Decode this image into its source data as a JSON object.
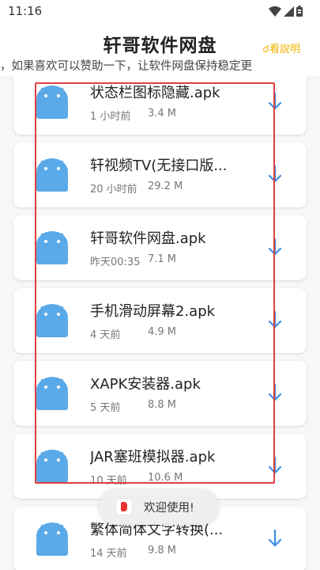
{
  "status_bar": {
    "time": "11:16"
  },
  "header": {
    "title": "轩哥软件网盘",
    "help_label": "看說明",
    "marquee": "，如果喜欢可以赞助一下，让软件网盘保持稳定更"
  },
  "files": [
    {
      "name": "状态栏图标隐藏.apk",
      "time": "1 小时前",
      "size": "3.4 M",
      "icon": "android-icon"
    },
    {
      "name": "轩视频TV(无接口版...",
      "time": "20 小时前",
      "size": "29.2 M",
      "icon": "android-icon"
    },
    {
      "name": "轩哥软件网盘.apk",
      "time": "昨天00:35",
      "size": "7.1 M",
      "icon": "android-icon"
    },
    {
      "name": "手机滑动屏幕2.apk",
      "time": "4 天前",
      "size": "4.9 M",
      "icon": "android-icon"
    },
    {
      "name": "XAPK安装器.apk",
      "time": "5 天前",
      "size": "8.8 M",
      "icon": "android-icon"
    },
    {
      "name": "JAR塞班模拟器.apk",
      "time": "10 天前",
      "size": "10.6 M",
      "icon": "android-icon"
    },
    {
      "name": "繁体简体文字转换(...",
      "time": "14 天前",
      "size": "9.8 M",
      "icon": "android-icon"
    }
  ],
  "toast": {
    "text": "欢迎使用!"
  },
  "colors": {
    "android": "#5aa9e8",
    "download_arrow": "#3a8ee6",
    "highlight": "#e04040",
    "help_link": "#f0b400"
  }
}
